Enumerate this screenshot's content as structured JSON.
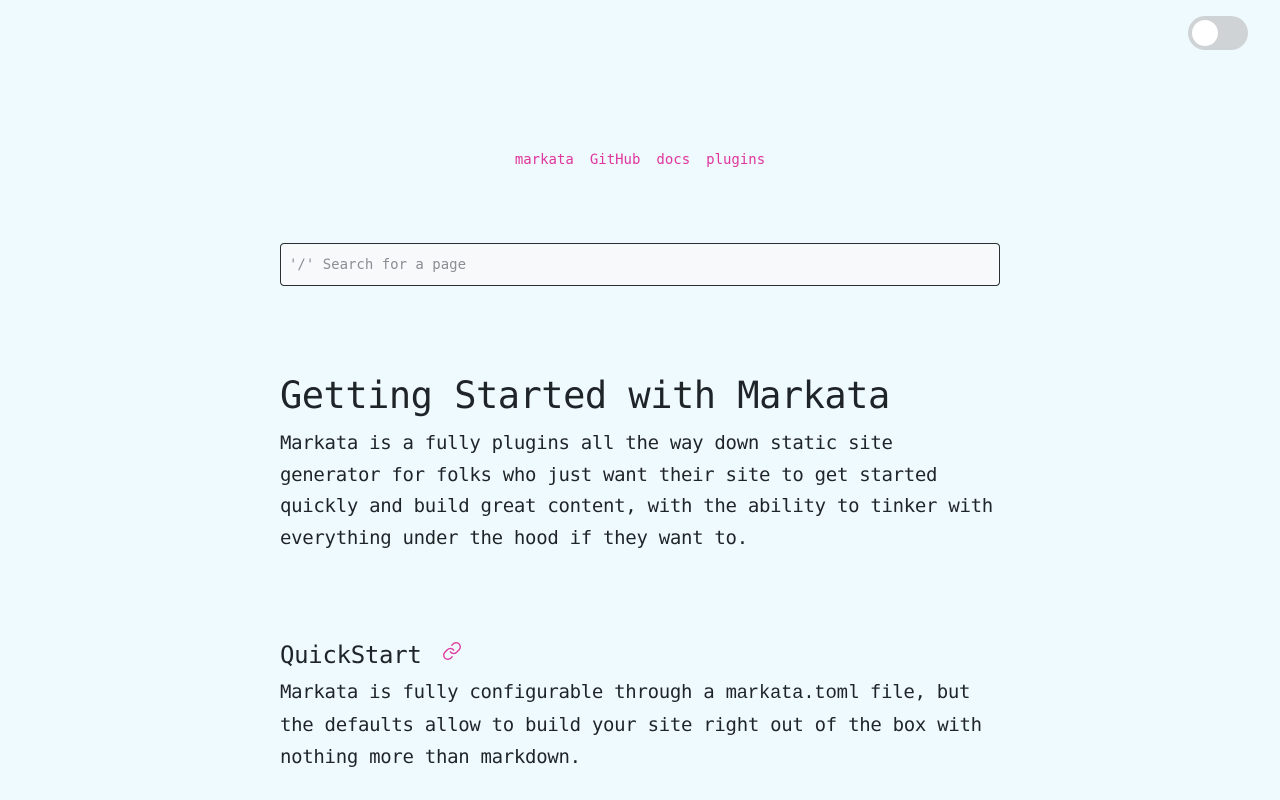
{
  "theme_toggle": {
    "state": "off"
  },
  "nav": {
    "items": [
      {
        "label": "markata"
      },
      {
        "label": "GitHub"
      },
      {
        "label": "docs"
      },
      {
        "label": "plugins"
      }
    ]
  },
  "search": {
    "placeholder": "'/' Search for a page",
    "value": ""
  },
  "article": {
    "title": "Getting Started with Markata",
    "intro": "Markata is a fully plugins all the way down static site generator for folks who just want their site to get started quickly and build great content, with the ability to tinker with everything under the hood if they want to.",
    "quickstart": {
      "heading": "QuickStart",
      "text_before": "Markata is fully configurable through a ",
      "code": "markata.toml",
      "text_after": " file, but the defaults allow to build your site right out of the box with nothing more than markdown."
    }
  },
  "colors": {
    "background": "#eefafd",
    "accent": "#e0369f",
    "text": "#1f2428"
  },
  "icons": {
    "heading_anchor": "link-icon"
  }
}
